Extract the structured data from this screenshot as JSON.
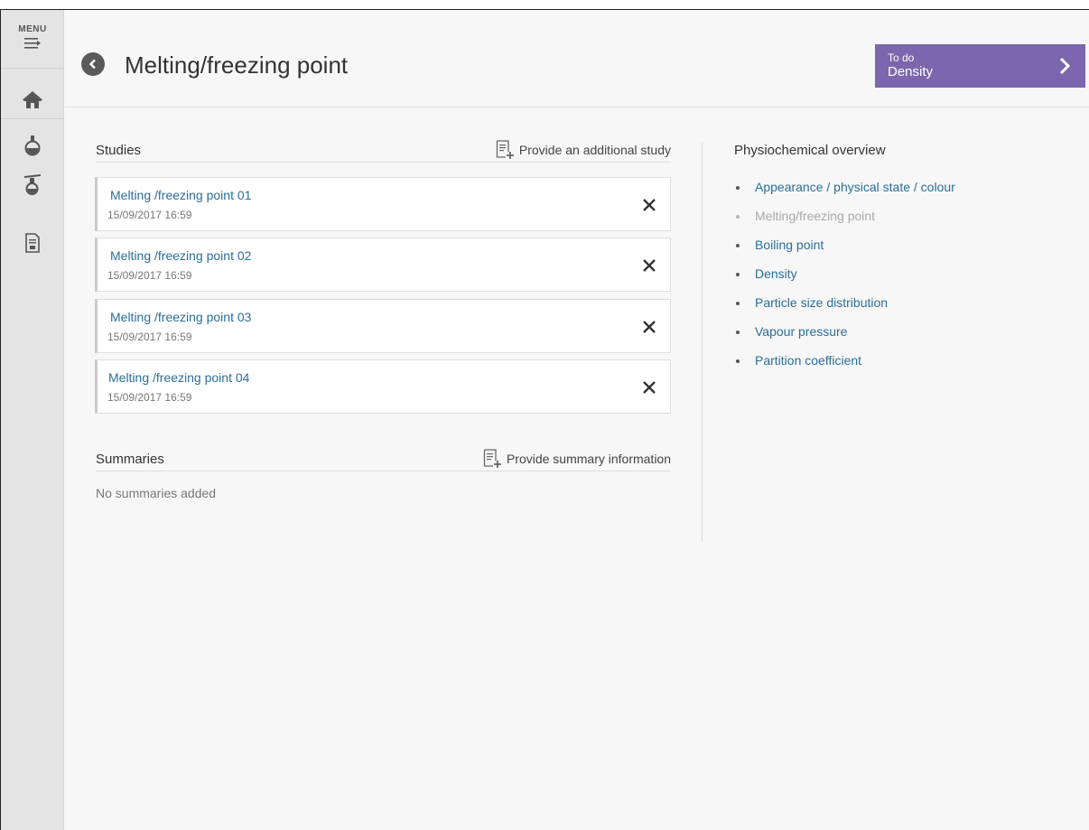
{
  "sidebar": {
    "menu_label": "MENU",
    "items": [
      {
        "icon": "home-icon"
      },
      {
        "icon": "flask-icon"
      },
      {
        "icon": "test-tube-icon"
      },
      {
        "icon": "document-icon"
      }
    ]
  },
  "header": {
    "title": "Melting/freezing point",
    "todo": {
      "small_label": "To do",
      "label": "Density"
    }
  },
  "studies": {
    "heading": "Studies",
    "action_label": "Provide an additional study",
    "items": [
      {
        "title": "Melting /freezing point 01",
        "date": "15/09/2017 16:59"
      },
      {
        "title": "Melting /freezing point 02",
        "date": "15/09/2017 16:59"
      },
      {
        "title": "Melting /freezing point 03",
        "date": "15/09/2017 16:59"
      },
      {
        "title": "Melting /freezing point 04",
        "date": "15/09/2017 16:59"
      }
    ]
  },
  "summaries": {
    "heading": "Summaries",
    "action_label": "Provide summary information",
    "empty_text": "No summaries added"
  },
  "overview": {
    "heading": "Physiochemical overview",
    "items": [
      {
        "label": "Appearance / physical state / colour"
      },
      {
        "label": "Melting/freezing point",
        "current": true
      },
      {
        "label": "Boiling point"
      },
      {
        "label": "Density"
      },
      {
        "label": "Particle size distribution"
      },
      {
        "label": "Vapour pressure"
      },
      {
        "label": "Partition coefficient"
      }
    ]
  },
  "colors": {
    "accent": "#7c66ad",
    "link": "#2a6e99"
  }
}
